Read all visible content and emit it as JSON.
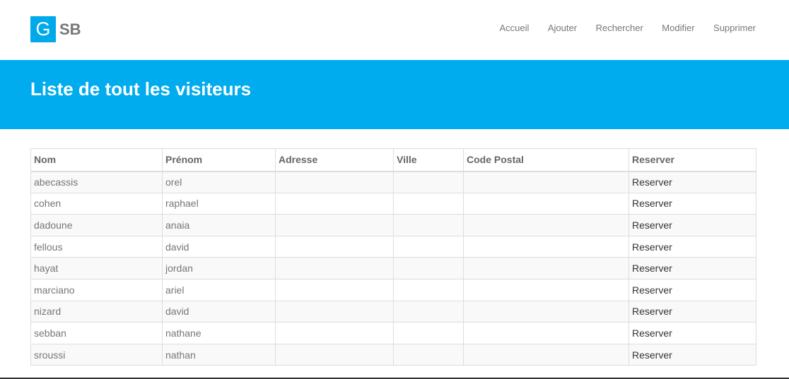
{
  "brand": {
    "logo_letter": "G",
    "logo_text": "SB",
    "accent_color": "#00acee"
  },
  "nav": {
    "items": [
      {
        "label": "Accueil"
      },
      {
        "label": "Ajouter"
      },
      {
        "label": "Rechercher"
      },
      {
        "label": "Modifier"
      },
      {
        "label": "Supprimer"
      }
    ]
  },
  "banner": {
    "title": "Liste de tout les visiteurs"
  },
  "table": {
    "headers": [
      "Nom",
      "Prénom",
      "Adresse",
      "Ville",
      "Code Postal",
      "Reserver"
    ],
    "rows": [
      {
        "nom": "abecassis",
        "prenom": "orel",
        "adresse": "",
        "ville": "",
        "code_postal": "",
        "reserver": "Reserver"
      },
      {
        "nom": "cohen",
        "prenom": "raphael",
        "adresse": "",
        "ville": "",
        "code_postal": "",
        "reserver": "Reserver"
      },
      {
        "nom": "dadoune",
        "prenom": "anaia",
        "adresse": "",
        "ville": "",
        "code_postal": "",
        "reserver": "Reserver"
      },
      {
        "nom": "fellous",
        "prenom": "david",
        "adresse": "",
        "ville": "",
        "code_postal": "",
        "reserver": "Reserver"
      },
      {
        "nom": "hayat",
        "prenom": "jordan",
        "adresse": "",
        "ville": "",
        "code_postal": "",
        "reserver": "Reserver"
      },
      {
        "nom": "marciano",
        "prenom": "ariel",
        "adresse": "",
        "ville": "",
        "code_postal": "",
        "reserver": "Reserver"
      },
      {
        "nom": "nizard",
        "prenom": "david",
        "adresse": "",
        "ville": "",
        "code_postal": "",
        "reserver": "Reserver"
      },
      {
        "nom": "sebban",
        "prenom": "nathane",
        "adresse": "",
        "ville": "",
        "code_postal": "",
        "reserver": "Reserver"
      },
      {
        "nom": "sroussi",
        "prenom": "nathan",
        "adresse": "",
        "ville": "",
        "code_postal": "",
        "reserver": "Reserver"
      }
    ]
  }
}
